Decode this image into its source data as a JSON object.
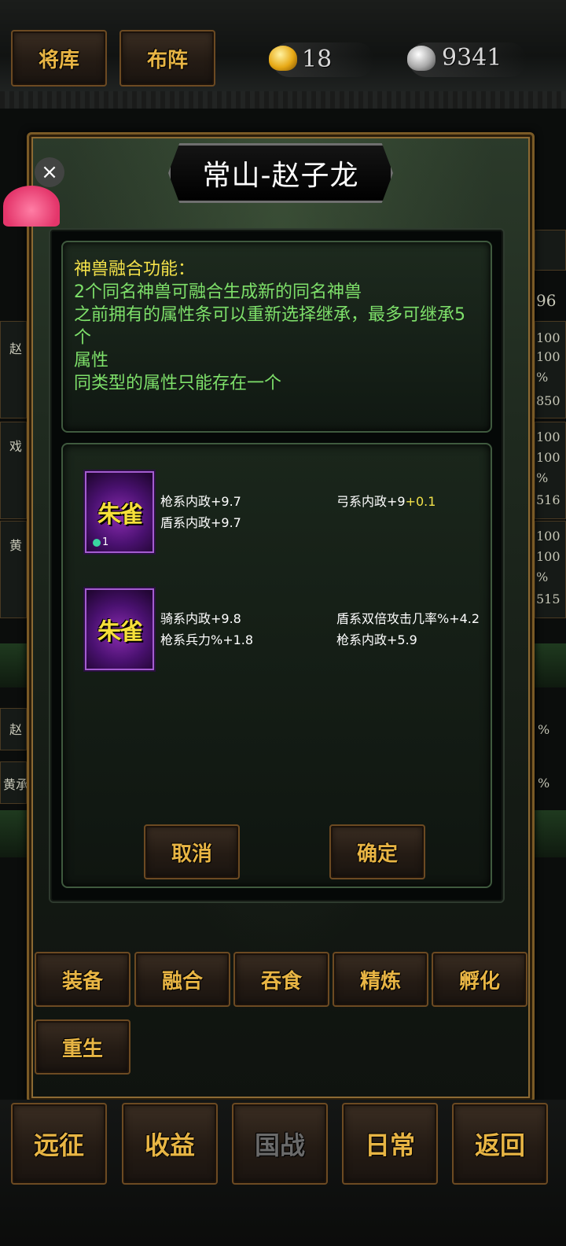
{
  "top_bar": {
    "buttons": [
      {
        "label": "将库"
      },
      {
        "label": "布阵"
      }
    ],
    "currency": {
      "gold": "18",
      "silver": "9341"
    }
  },
  "background_side": {
    "right_number": "96",
    "left_names": [
      "赵",
      "戏",
      "黄"
    ],
    "right_values": [
      [
        "100",
        "100",
        "%",
        "850"
      ],
      [
        "100",
        "100",
        "%",
        "516"
      ],
      [
        "100",
        "100",
        "%",
        "515"
      ]
    ],
    "lower_rows": [
      {
        "left": "赵",
        "right": "%"
      },
      {
        "left": "黄承",
        "right": "%"
      }
    ]
  },
  "dialog": {
    "title": "常山-赵子龙",
    "close_icon": "×",
    "info": {
      "title": "神兽融合功能：",
      "lines": [
        "2个同名神兽可融合生成新的同名神兽",
        "之前拥有的属性条可以重新选择继承，最多可继承5个",
        "属性",
        "同类型的属性只能存在一个"
      ]
    },
    "beasts": [
      {
        "name": "朱雀",
        "level": "1",
        "attrs": [
          {
            "text": "枪系内政+9.7",
            "bonus": ""
          },
          {
            "text": "弓系内政+9",
            "bonus": "+0.1"
          },
          {
            "text": "盾系内政+9.7",
            "bonus": ""
          }
        ]
      },
      {
        "name": "朱雀",
        "level": "",
        "attrs": [
          {
            "text": "骑系内政+9.8",
            "bonus": ""
          },
          {
            "text": "盾系双倍攻击几率%+4.2",
            "bonus": ""
          },
          {
            "text": "枪系兵力%+1.8",
            "bonus": ""
          },
          {
            "text": "枪系内政+5.9",
            "bonus": ""
          }
        ]
      }
    ],
    "cancel_label": "取消",
    "confirm_label": "确定",
    "tabs": [
      "装备",
      "融合",
      "吞食",
      "精炼",
      "孵化",
      "重生"
    ]
  },
  "bottom_nav": [
    "远征",
    "收益",
    "国战",
    "日常",
    "返回"
  ]
}
